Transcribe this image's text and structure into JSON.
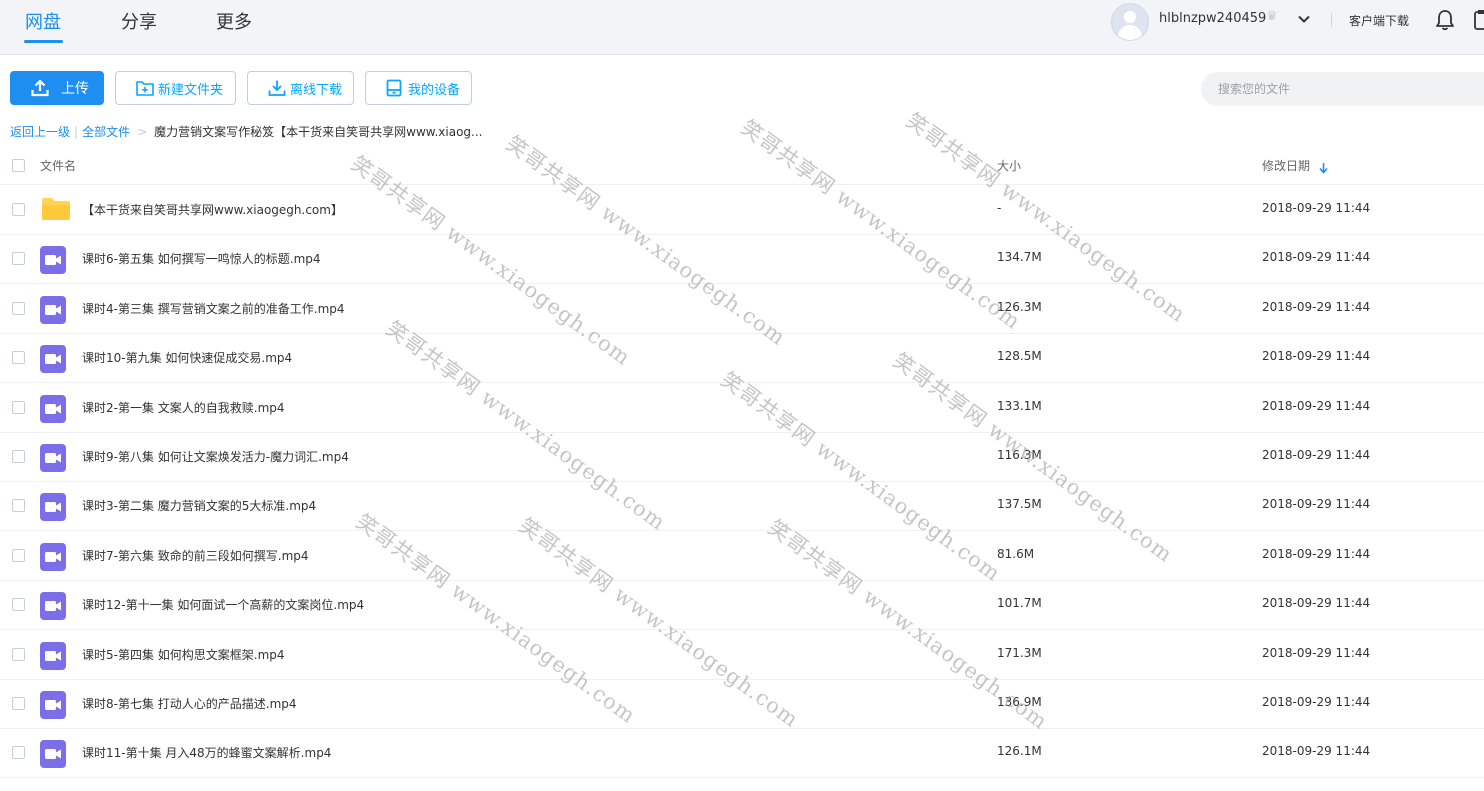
{
  "nav": {
    "tabs": [
      {
        "label": "网盘",
        "active": true
      },
      {
        "label": "分享",
        "active": false
      },
      {
        "label": "更多",
        "active": false
      }
    ],
    "username": "hlblnzpw240459",
    "client_download": "客户端下载",
    "icons": [
      "avatar",
      "crown-icon",
      "chevron-down-icon",
      "bell-icon",
      "clipboard-icon"
    ]
  },
  "toolbar": {
    "upload": "上传",
    "new_folder": "新建文件夹",
    "offline_download": "离线下载",
    "my_devices": "我的设备",
    "search_placeholder": "搜索您的文件",
    "accent_color": "#1e8ef0"
  },
  "breadcrumb": {
    "back": "返回上一级",
    "sep1": "|",
    "all_files": "全部文件",
    "sep2": ">",
    "current": "魔力营销文案写作秘笈【本干货来自笑哥共享网www.xiaog..."
  },
  "table": {
    "headers": {
      "name": "文件名",
      "size": "大小",
      "date": "修改日期",
      "sort_icon": "arrow-down-icon"
    },
    "rows": [
      {
        "type": "folder",
        "name": "【本干货来自笑哥共享网www.xiaogegh.com】",
        "size": "-",
        "date": "2018-09-29 11:44"
      },
      {
        "type": "video",
        "name": "课时6-第五集 如何撰写一鸣惊人的标题.mp4",
        "size": "134.7M",
        "date": "2018-09-29 11:44"
      },
      {
        "type": "video",
        "name": "课时4-第三集 撰写营销文案之前的准备工作.mp4",
        "size": "126.3M",
        "date": "2018-09-29 11:44"
      },
      {
        "type": "video",
        "name": "课时10-第九集 如何快速促成交易.mp4",
        "size": "128.5M",
        "date": "2018-09-29 11:44"
      },
      {
        "type": "video",
        "name": "课时2-第一集 文案人的自我救赎.mp4",
        "size": "133.1M",
        "date": "2018-09-29 11:44"
      },
      {
        "type": "video",
        "name": "课时9-第八集 如何让文案焕发活力-魔力词汇.mp4",
        "size": "116.3M",
        "date": "2018-09-29 11:44"
      },
      {
        "type": "video",
        "name": "课时3-第二集 魔力营销文案的5大标准.mp4",
        "size": "137.5M",
        "date": "2018-09-29 11:44"
      },
      {
        "type": "video",
        "name": "课时7-第六集 致命的前三段如何撰写.mp4",
        "size": "81.6M",
        "date": "2018-09-29 11:44"
      },
      {
        "type": "video",
        "name": "课时12-第十一集 如何面试一个高薪的文案岗位.mp4",
        "size": "101.7M",
        "date": "2018-09-29 11:44"
      },
      {
        "type": "video",
        "name": "课时5-第四集 如何构思文案框架.mp4",
        "size": "171.3M",
        "date": "2018-09-29 11:44"
      },
      {
        "type": "video",
        "name": "课时8-第七集 打动人心的产品描述.mp4",
        "size": "136.9M",
        "date": "2018-09-29 11:44"
      },
      {
        "type": "video",
        "name": "课时11-第十集 月入48万的蜂蜜文案解析.mp4",
        "size": "126.1M",
        "date": "2018-09-29 11:44"
      }
    ]
  },
  "watermark": {
    "text": "笑哥共享网 www.xiaogegh.com"
  }
}
